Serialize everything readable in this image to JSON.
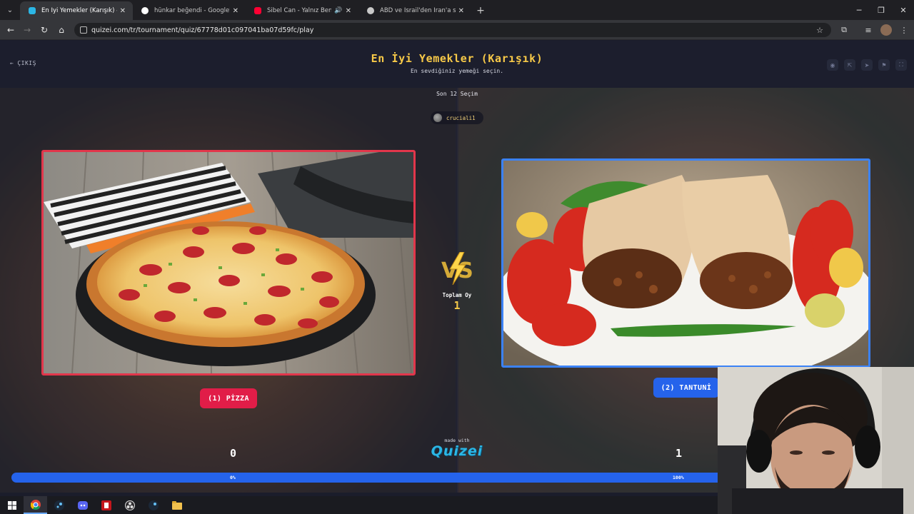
{
  "browser": {
    "tabs": [
      {
        "title": "En İyi Yemekler (Karışık) - Tier Li",
        "active": true,
        "favicon_color": "#2bb6e5",
        "icon": "quizei-favicon"
      },
      {
        "title": "hünkar beğendi - Google'da Ar",
        "active": false,
        "favicon_color": "#4285f4",
        "icon": "google-favicon"
      },
      {
        "title": "Sibel Can - Yalnız Beni Sev",
        "active": false,
        "favicon_color": "#ff0033",
        "icon": "youtube-favicon",
        "audio": "speaker-icon"
      },
      {
        "title": "ABD ve İsrail'den İran'a saldırı",
        "active": false,
        "favicon_color": "#c0c0c0",
        "icon": "news-favicon"
      }
    ],
    "new_tab": "+",
    "url": "quizei.com/tr/tournament/quiz/67778d01c097041ba07d59fc/play"
  },
  "header": {
    "exit_label": "ÇIKIŞ",
    "title": "En İyi Yemekler (Karışık)",
    "subtitle": "En sevdiğiniz yemeği seçin.",
    "icons": [
      "eye-icon",
      "share-icon",
      "send-icon",
      "flag-icon",
      "fullscreen-icon"
    ]
  },
  "arena": {
    "round_label": "Son 12 Seçim",
    "user_name": "cruciali1",
    "left": {
      "label": "(1) PİZZA",
      "score": "0",
      "percent": "0%",
      "vote_fraction": 0,
      "color": "#e11d48"
    },
    "right": {
      "label": "(2) TANTUNİ",
      "score": "1",
      "percent": "100%",
      "vote_fraction": 1,
      "color": "#2563eb"
    },
    "vs_label": "VS",
    "total_votes_label": "Toplam Oy",
    "total_votes_value": "1",
    "made_with": "made with",
    "brand": "Quizei"
  },
  "taskbar": {
    "apps": [
      "windows-start-icon",
      "chrome-icon",
      "steam-icon",
      "discord-icon",
      "media-app-icon",
      "obs-icon",
      "steam-icon",
      "file-explorer-icon"
    ]
  }
}
